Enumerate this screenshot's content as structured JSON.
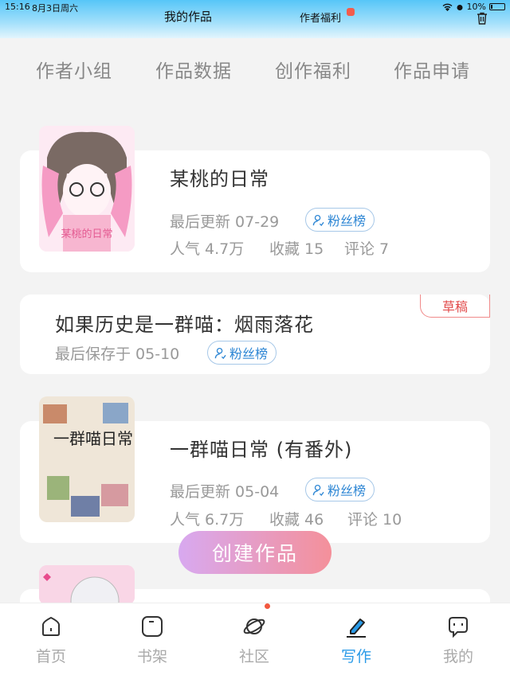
{
  "status_bar": {
    "time": "15:16",
    "date": "8月3日周六",
    "battery": "10%"
  },
  "header": {
    "title": "我的作品",
    "benefit": "作者福利"
  },
  "top_nav": [
    "作者小组",
    "作品数据",
    "创作福利",
    "作品申请"
  ],
  "works": [
    {
      "title": "某桃的日常",
      "updated": "最后更新 07-29",
      "fans_label": "粉丝榜",
      "popularity": "人气 4.7万",
      "favorites": "收藏 15",
      "comments": "评论 7",
      "cover_text": "某桃的日常"
    },
    {
      "title": "如果历史是一群喵：烟雨落花",
      "saved": "最后保存于 05-10",
      "fans_label": "粉丝榜",
      "tag": "草稿"
    },
    {
      "title": "一群喵日常 (有番外)",
      "updated": "最后更新 05-04",
      "fans_label": "粉丝榜",
      "popularity": "人气 6.7万",
      "favorites": "收藏 46",
      "comments": "评论 10",
      "cover_text": "一群喵日常"
    }
  ],
  "create_button": "创建作品",
  "tab_bar": [
    {
      "label": "首页",
      "icon": "home-icon"
    },
    {
      "label": "书架",
      "icon": "bookshelf-icon"
    },
    {
      "label": "社区",
      "icon": "planet-icon"
    },
    {
      "label": "写作",
      "icon": "pen-icon",
      "active": true
    },
    {
      "label": "我的",
      "icon": "chat-icon"
    }
  ],
  "colors": {
    "accent": "#2a9be8",
    "draft": "#e24b4b",
    "header": "#57c6f8"
  }
}
